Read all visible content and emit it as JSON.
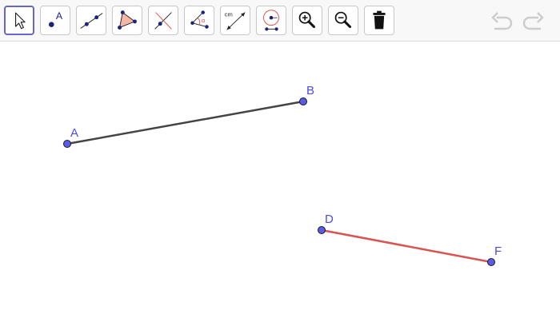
{
  "toolbar": {
    "tools": [
      {
        "name": "move",
        "icon": "cursor-arrow-icon",
        "selected": true
      },
      {
        "name": "point",
        "icon": "point-icon",
        "label": "A"
      },
      {
        "name": "line",
        "icon": "line-through-two-points-icon"
      },
      {
        "name": "polygon",
        "icon": "polygon-icon"
      },
      {
        "name": "perpendicular",
        "icon": "perpendicular-line-icon"
      },
      {
        "name": "angle",
        "icon": "angle-icon",
        "label": "α"
      },
      {
        "name": "distance",
        "icon": "distance-icon",
        "label": "cm"
      },
      {
        "name": "circle",
        "icon": "circle-center-point-icon"
      },
      {
        "name": "zoom-in",
        "icon": "zoom-in-icon"
      },
      {
        "name": "zoom-out",
        "icon": "zoom-out-icon"
      },
      {
        "name": "delete",
        "icon": "trash-icon"
      }
    ],
    "undo_icon": "undo-icon",
    "redo_icon": "redo-icon"
  },
  "canvas": {
    "points": [
      {
        "label": "A"
      },
      {
        "label": "B"
      },
      {
        "label": "D"
      },
      {
        "label": "F"
      }
    ],
    "segments": [
      {
        "from": "A",
        "to": "B",
        "color": "#444444"
      },
      {
        "from": "D",
        "to": "F",
        "color": "#d9534f"
      }
    ],
    "point_color": "#5a5aeb",
    "label_color": "#4c4ce0"
  }
}
